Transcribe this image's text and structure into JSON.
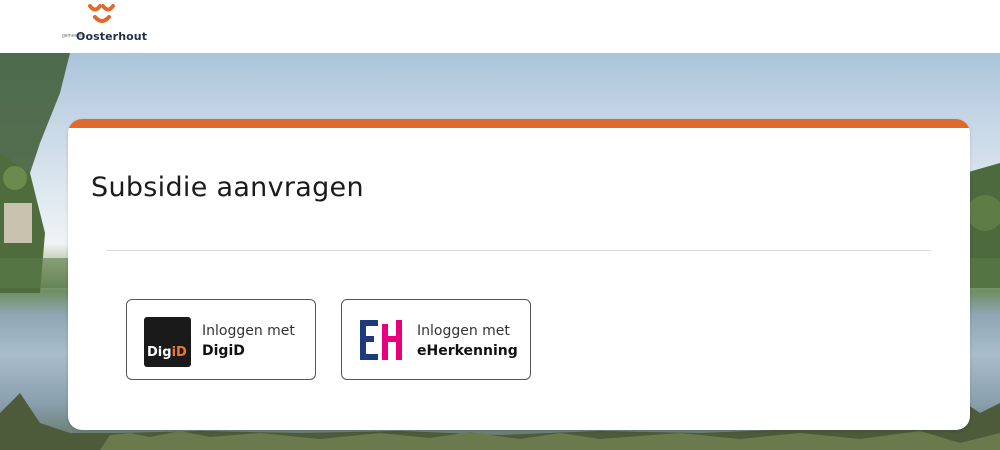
{
  "header": {
    "logo_small": "gemeente",
    "logo_name": "Oosterhout",
    "logo_icon": "oosterhout-logo-icon"
  },
  "card": {
    "title": "Subsidie aanvragen",
    "accent_color": "#e06a2c"
  },
  "login": {
    "digid": {
      "line1": "Inloggen met",
      "line2": "DigiD",
      "logo_text_main": "Dig",
      "logo_text_accent": "iD"
    },
    "eherkenning": {
      "line1": "Inloggen met",
      "line2": "eHerkenning",
      "logo_icon": "eherkenning-logo-icon"
    }
  },
  "colors": {
    "orange": "#e06a2c",
    "eh_blue": "#1d3b7a",
    "eh_pink": "#e6007e"
  }
}
